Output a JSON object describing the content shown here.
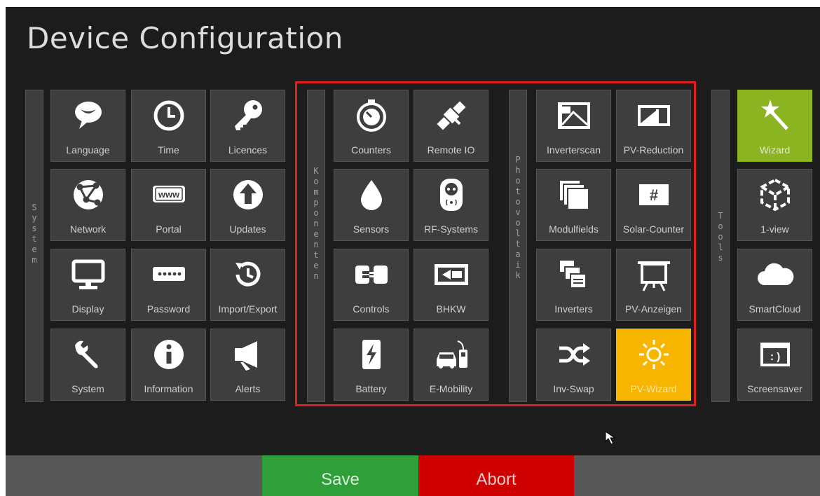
{
  "title": "Device Configuration",
  "groups": {
    "system": {
      "letters": [
        "S",
        "y",
        "s",
        "t",
        "e",
        "m"
      ]
    },
    "komponenten": {
      "letters": [
        "K",
        "o",
        "m",
        "p",
        "o",
        "n",
        "e",
        "n",
        "t",
        "e",
        "n"
      ]
    },
    "photovoltaik": {
      "letters": [
        "P",
        "h",
        "o",
        "t",
        "o",
        "v",
        "o",
        "l",
        "t",
        "a",
        "i",
        "k"
      ]
    },
    "tools": {
      "letters": [
        "T",
        "o",
        "o",
        "l",
        "s"
      ]
    }
  },
  "tiles": {
    "language": "Language",
    "time": "Time",
    "licences": "Licences",
    "network": "Network",
    "portal": "Portal",
    "updates": "Updates",
    "display": "Display",
    "password": "Password",
    "import_export": "Import/Export",
    "system": "System",
    "information": "Information",
    "alerts": "Alerts",
    "counters": "Counters",
    "remote_io": "Remote IO",
    "sensors": "Sensors",
    "rf_systems": "RF-Systems",
    "controls": "Controls",
    "bhkw": "BHKW",
    "battery": "Battery",
    "e_mobility": "E-Mobility",
    "inverterscan": "Inverterscan",
    "pv_reduction": "PV-Reduction",
    "modulfields": "Modulfields",
    "solar_counter": "Solar-Counter",
    "inverters": "Inverters",
    "pv_anzeigen": "PV-Anzeigen",
    "inv_swap": "Inv-Swap",
    "pv_wizard": "PV-Wizard",
    "wizard": "Wizard",
    "one_view": "1-view",
    "smartcloud": "SmartCloud",
    "screensaver": "Screensaver"
  },
  "icon_text": {
    "portal": "www",
    "solar_counter": "#",
    "screensaver": ":)"
  },
  "buttons": {
    "save": "Save",
    "abort": "Abort"
  },
  "colors": {
    "accent_green": "#8cb421",
    "accent_yellow": "#f7b500",
    "highlight_red": "#e02020",
    "save_green": "#2f9f3a",
    "abort_red": "#cf0000"
  }
}
